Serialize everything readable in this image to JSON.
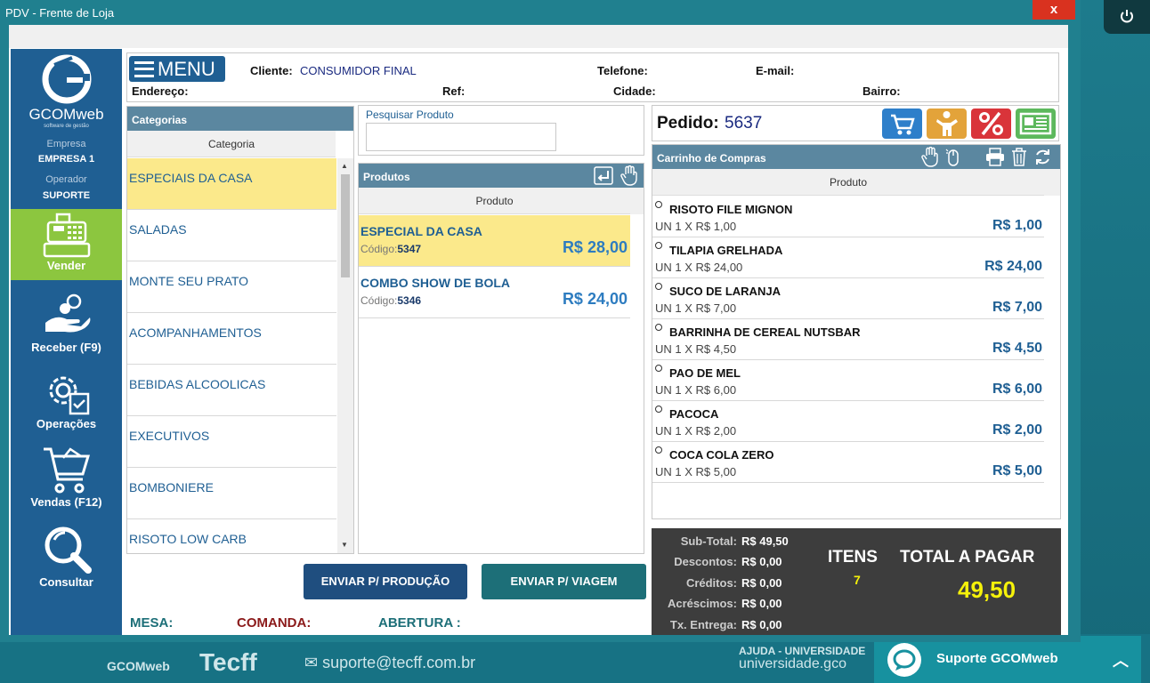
{
  "window": {
    "title": "PDV - Frente de Loja",
    "close_label": "x"
  },
  "sidebar": {
    "brand": "GCOMweb",
    "tagline": "software de gestão",
    "empresa_label": "Empresa",
    "empresa_value": "EMPRESA 1",
    "operador_label": "Operador",
    "operador_value": "SUPORTE",
    "buttons": [
      {
        "label": "Vender",
        "icon": "cash-register-icon",
        "active": true
      },
      {
        "label": "Receber (F9)",
        "icon": "hand-coin-icon"
      },
      {
        "label": "Operações",
        "icon": "gear-checklist-icon"
      },
      {
        "label": "Vendas (F12)",
        "icon": "shopping-cart-icon"
      },
      {
        "label": "Consultar",
        "icon": "magnifier-icon"
      }
    ]
  },
  "header": {
    "menu_label": "MENU",
    "cliente_label": "Cliente:",
    "cliente_value": "CONSUMIDOR FINAL",
    "telefone_label": "Telefone:",
    "email_label": "E-mail:",
    "endereco_label": "Endereço:",
    "ref_label": "Ref:",
    "cidade_label": "Cidade:",
    "bairro_label": "Bairro:"
  },
  "categorias": {
    "title": "Categorias",
    "column": "Categoria",
    "items": [
      "ESPECIAIS DA CASA",
      "SALADAS",
      "MONTE SEU PRATO",
      "ACOMPANHAMENTOS",
      "BEBIDAS ALCOOLICAS",
      "EXECUTIVOS",
      "BOMBONIERE",
      "RISOTO LOW CARB"
    ]
  },
  "search": {
    "label": "Pesquisar Produto",
    "value": ""
  },
  "produtos": {
    "title": "Produtos",
    "column": "Produto",
    "items": [
      {
        "name": "ESPECIAL DA CASA",
        "code_label": "Código:",
        "code": "5347",
        "price": "R$ 28,00"
      },
      {
        "name": "COMBO SHOW DE BOLA",
        "code_label": "Código:",
        "code": "5346",
        "price": "R$ 24,00"
      }
    ]
  },
  "pedido": {
    "label": "Pedido:",
    "value": "5637"
  },
  "carrinho": {
    "title": "Carrinho de Compras",
    "column": "Produto",
    "items": [
      {
        "name": "RISOTO FILE MIGNON",
        "qty": "UN 1 X R$ 1,00",
        "price": "R$ 1,00"
      },
      {
        "name": "TILAPIA GRELHADA",
        "qty": "UN 1 X R$ 24,00",
        "price": "R$ 24,00"
      },
      {
        "name": "SUCO DE LARANJA",
        "qty": "UN 1 X R$ 7,00",
        "price": "R$ 7,00"
      },
      {
        "name": "BARRINHA DE CEREAL NUTSBAR",
        "qty": "UN 1 X R$ 4,50",
        "price": "R$ 4,50"
      },
      {
        "name": "PAO DE MEL",
        "qty": "UN 1 X R$ 6,00",
        "price": "R$ 6,00"
      },
      {
        "name": "PACOCA",
        "qty": "UN 1 X R$ 2,00",
        "price": "R$ 2,00"
      },
      {
        "name": "COCA COLA ZERO",
        "qty": "UN 1 X R$ 5,00",
        "price": "R$ 5,00"
      }
    ]
  },
  "actions": {
    "producao": "ENVIAR P/ PRODUÇÃO",
    "viagem": "ENVIAR P/ VIAGEM"
  },
  "footer": {
    "mesa": "MESA:",
    "comanda": "COMANDA:",
    "abertura": "ABERTURA :"
  },
  "totals": {
    "subtotal_label": "Sub-Total:",
    "subtotal": "R$ 49,50",
    "descontos_label": "Descontos:",
    "descontos": "R$ 0,00",
    "creditos_label": "Créditos:",
    "creditos": "R$ 0,00",
    "acrescimos_label": "Acréscimos:",
    "acrescimos": "R$ 0,00",
    "entrega_label": "Tx. Entrega:",
    "entrega": "R$ 0,00",
    "itens_label": "ITENS",
    "itens": "7",
    "total_label": "TOTAL A PAGAR",
    "total": "49,50"
  },
  "desktop": {
    "brand1": "GCOMweb",
    "brand2": "Tecff",
    "email": "suporte@tecff.com.br",
    "ajuda": "AJUDA - UNIVERSIDADE",
    "univ": "universidade.gco",
    "suporte": "Suporte GCOMweb"
  },
  "colors": {
    "sidebar": "#1f5f93",
    "active": "#8cc63f",
    "highlight": "#fbe98b",
    "panel_head": "#5b87a0",
    "total_yellow": "#f5f10a"
  }
}
